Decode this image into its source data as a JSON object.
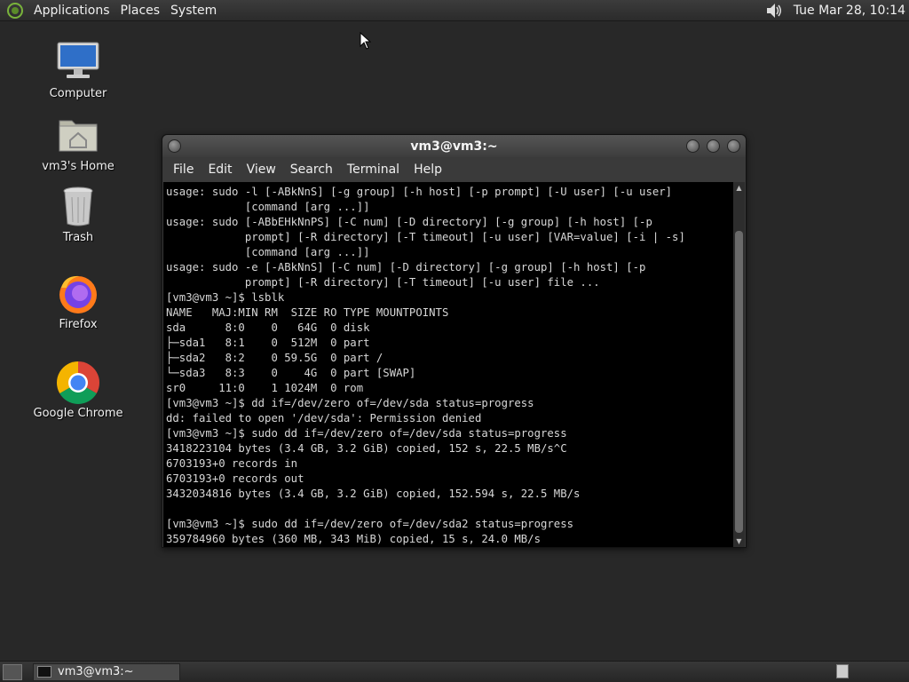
{
  "top_panel": {
    "menus": [
      "Applications",
      "Places",
      "System"
    ],
    "clock": "Tue Mar 28, 10:14"
  },
  "desktop_icons": [
    {
      "label": "Computer",
      "icon": "computer-icon"
    },
    {
      "label": "vm3's Home",
      "icon": "home-folder-icon"
    },
    {
      "label": "Trash",
      "icon": "trash-icon"
    },
    {
      "label": "Firefox",
      "icon": "firefox-icon"
    },
    {
      "label": "Google Chrome",
      "icon": "chrome-icon"
    }
  ],
  "window": {
    "title": "vm3@vm3:~",
    "menus": [
      "File",
      "Edit",
      "View",
      "Search",
      "Terminal",
      "Help"
    ],
    "terminal_lines": [
      "usage: sudo -l [-ABkNnS] [-g group] [-h host] [-p prompt] [-U user] [-u user]",
      "            [command [arg ...]]",
      "usage: sudo [-ABbEHkNnPS] [-C num] [-D directory] [-g group] [-h host] [-p",
      "            prompt] [-R directory] [-T timeout] [-u user] [VAR=value] [-i | -s]",
      "            [command [arg ...]]",
      "usage: sudo -e [-ABkNnS] [-C num] [-D directory] [-g group] [-h host] [-p",
      "            prompt] [-R directory] [-T timeout] [-u user] file ...",
      "[vm3@vm3 ~]$ lsblk",
      "NAME   MAJ:MIN RM  SIZE RO TYPE MOUNTPOINTS",
      "sda      8:0    0   64G  0 disk",
      "├─sda1   8:1    0  512M  0 part",
      "├─sda2   8:2    0 59.5G  0 part /",
      "└─sda3   8:3    0    4G  0 part [SWAP]",
      "sr0     11:0    1 1024M  0 rom",
      "[vm3@vm3 ~]$ dd if=/dev/zero of=/dev/sda status=progress",
      "dd: failed to open '/dev/sda': Permission denied",
      "[vm3@vm3 ~]$ sudo dd if=/dev/zero of=/dev/sda status=progress",
      "3418223104 bytes (3.4 GB, 3.2 GiB) copied, 152 s, 22.5 MB/s^C",
      "6703193+0 records in",
      "6703193+0 records out",
      "3432034816 bytes (3.4 GB, 3.2 GiB) copied, 152.594 s, 22.5 MB/s",
      "",
      "[vm3@vm3 ~]$ sudo dd if=/dev/zero of=/dev/sda2 status=progress",
      "359784960 bytes (360 MB, 343 MiB) copied, 15 s, 24.0 MB/s"
    ]
  },
  "taskbar": {
    "task_label": "vm3@vm3:~"
  }
}
